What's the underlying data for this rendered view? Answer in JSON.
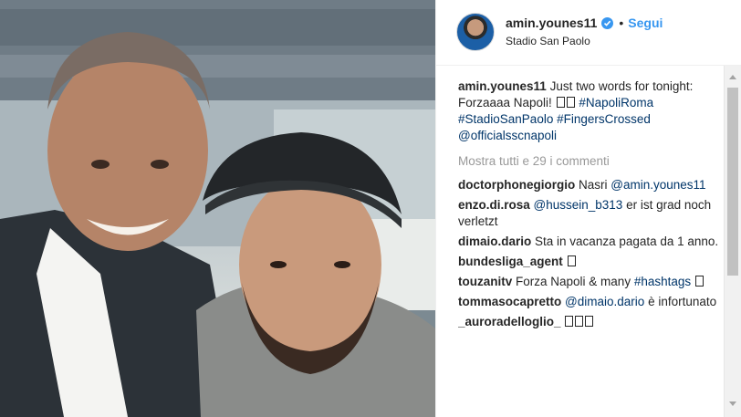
{
  "header": {
    "username": "amin.younes11",
    "separator": "•",
    "follow_label": "Segui",
    "location": "Stadio San Paolo"
  },
  "caption": {
    "username": "amin.younes11",
    "text": "Just two words for tonight: Forzaaaa Napoli!",
    "hashtags": [
      "#NapoliRoma",
      "#StadioSanPaolo",
      "#FingersCrossed"
    ],
    "mention": "@officialsscnapoli"
  },
  "view_all_label": "Mostra tutti e 29 i commenti",
  "comments": [
    {
      "user": "doctorphonegiorgio",
      "text": "Nasri",
      "mention": "@amin.younes11"
    },
    {
      "user": "enzo.di.rosa",
      "mention": "@hussein_b313",
      "text": "er ist grad noch verletzt"
    },
    {
      "user": "dimaio.dario",
      "text": "Sta in vacanza pagata da 1 anno."
    },
    {
      "user": "bundesliga_agent",
      "text": ""
    },
    {
      "user": "touzanitv",
      "text": "Forza Napoli & many",
      "hashtag": "#hashtags"
    },
    {
      "user": "tommasocapretto",
      "mention": "@dimaio.dario",
      "text": "è infortunato"
    },
    {
      "user": "_auroradelloglio_",
      "text": ""
    }
  ],
  "icons": {
    "verified": "verified-badge-icon",
    "emoji": "emoji-glyph"
  },
  "colors": {
    "accent": "#3897f0",
    "link": "#003569",
    "muted": "#999999",
    "text": "#262626"
  }
}
